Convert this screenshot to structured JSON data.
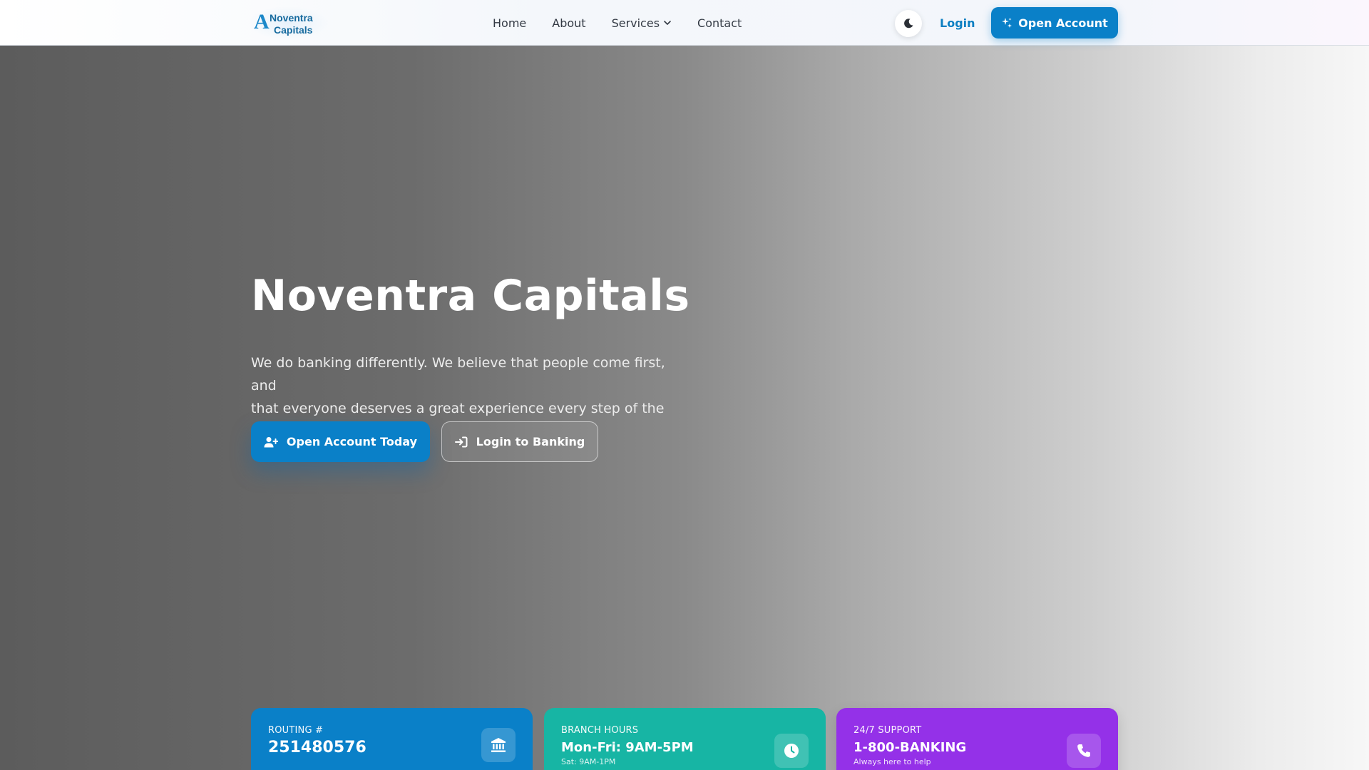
{
  "brand": {
    "logo_mark": "A",
    "logo_line1": "Noventra",
    "logo_line2": "Capitals"
  },
  "nav": {
    "items": [
      {
        "label": "Home"
      },
      {
        "label": "About"
      },
      {
        "label": "Services",
        "has_dropdown": true
      },
      {
        "label": "Contact"
      }
    ]
  },
  "header_actions": {
    "theme_icon": "moon-icon",
    "login_label": "Login",
    "open_account_label": "Open Account",
    "open_account_icon": "sparkles-icon"
  },
  "hero": {
    "title": "Noventra Capitals",
    "subtitle_line1": "We do banking differently. We believe that people come first, and",
    "subtitle_line2": "that everyone deserves a great experience every step of the way.",
    "primary_cta": {
      "label": "Open Account Today",
      "icon": "user-plus-icon"
    },
    "secondary_cta": {
      "label": "Login to Banking",
      "icon": "sign-in-icon"
    }
  },
  "cards": [
    {
      "label": "ROUTING #",
      "value": "251480576",
      "note": "",
      "icon": "bank-icon",
      "color": "#0a80c8"
    },
    {
      "label": "BRANCH HOURS",
      "value": "Mon-Fri: 9AM-5PM",
      "note": "Sat: 9AM-1PM",
      "icon": "clock-icon",
      "color": "#17b5a4"
    },
    {
      "label": "24/7 SUPPORT",
      "value": "1-800-BANKING",
      "note": "Always here to help",
      "icon": "phone-icon",
      "color": "#9431e8"
    }
  ],
  "colors": {
    "primary": "#0a80c8",
    "teal": "#17b5a4",
    "purple": "#9431e8"
  }
}
